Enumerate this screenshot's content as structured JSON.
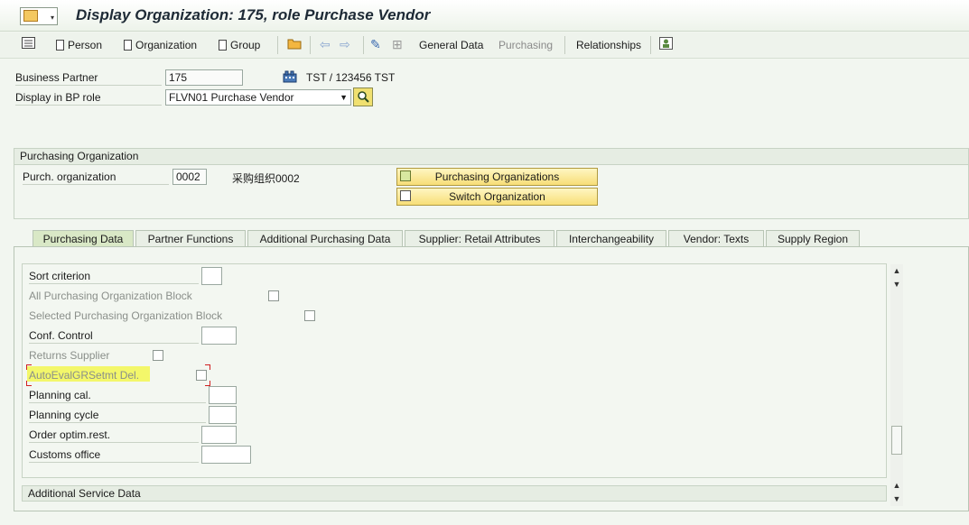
{
  "window": {
    "title": "Display Organization: 175, role Purchase Vendor"
  },
  "toolbar": {
    "person": "Person",
    "organization": "Organization",
    "group": "Group",
    "general_data": "General Data",
    "purchasing": "Purchasing",
    "relationships": "Relationships"
  },
  "header": {
    "bp_label": "Business Partner",
    "bp_value": "175",
    "bp_desc": "TST / 123456 TST",
    "role_label": "Display in BP role",
    "role_value": "FLVN01 Purchase Vendor"
  },
  "purch_org": {
    "section_title": "Purchasing Organization",
    "label": "Purch. organization",
    "value": "0002",
    "desc": "采购组织0002",
    "btn_orgs": "Purchasing Organizations",
    "btn_switch": "Switch Organization"
  },
  "tabs": [
    {
      "label": "Purchasing Data",
      "active": true
    },
    {
      "label": "Partner Functions"
    },
    {
      "label": "Additional Purchasing Data"
    },
    {
      "label": "Supplier: Retail Attributes"
    },
    {
      "label": "Interchangeability"
    },
    {
      "label": "Vendor: Texts"
    },
    {
      "label": "Supply Region"
    }
  ],
  "fields": {
    "sort_criterion": "Sort criterion",
    "all_po_block": "All Purchasing Organization Block",
    "sel_po_block": "Selected Purchasing Organization Block",
    "conf_control": "Conf. Control",
    "returns_supplier": "Returns Supplier",
    "auto_eval": "AutoEvalGRSetmt Del.",
    "planning_cal": "Planning cal.",
    "planning_cycle": "Planning cycle",
    "order_optim": "Order optim.rest.",
    "customs_office": "Customs office"
  },
  "additional_service": {
    "title": "Additional Service Data"
  },
  "colors": {
    "highlight": "#f3f76a",
    "active_tab": "#d9e8c6",
    "button": "#f7de77"
  }
}
